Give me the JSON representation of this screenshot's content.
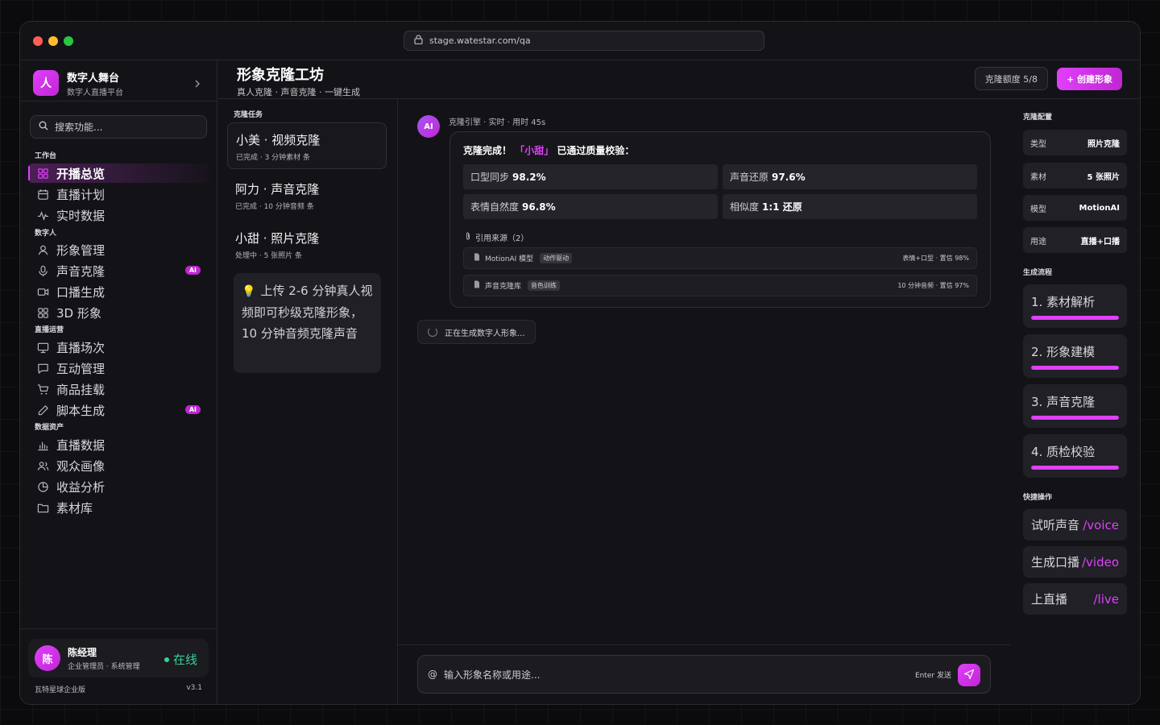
{
  "browser": {
    "url": "stage.watestar.com/qa"
  },
  "sidebar": {
    "brand_logo": "人",
    "brand_title": "数字人舞台",
    "brand_sub": "数字人直播平台",
    "search_placeholder": "搜索功能...",
    "groups": [
      {
        "label": "工作台",
        "items": [
          {
            "label": "开播总览",
            "icon": "grid-icon",
            "active": true
          },
          {
            "label": "直播计划",
            "icon": "calendar-icon"
          },
          {
            "label": "实时数据",
            "icon": "activity-icon"
          }
        ]
      },
      {
        "label": "数字人",
        "items": [
          {
            "label": "形象管理",
            "icon": "user-icon"
          },
          {
            "label": "声音克隆",
            "icon": "mic-icon",
            "badge": "AI"
          },
          {
            "label": "口播生成",
            "icon": "video-icon"
          },
          {
            "label": "3D 形象",
            "icon": "grid-icon"
          }
        ]
      },
      {
        "label": "直播运营",
        "items": [
          {
            "label": "直播场次",
            "icon": "monitor-icon"
          },
          {
            "label": "互动管理",
            "icon": "message-icon"
          },
          {
            "label": "商品挂载",
            "icon": "cart-icon"
          },
          {
            "label": "脚本生成",
            "icon": "pen-icon",
            "badge": "AI"
          }
        ]
      },
      {
        "label": "数据资产",
        "items": [
          {
            "label": "直播数据",
            "icon": "bar-chart-icon"
          },
          {
            "label": "观众画像",
            "icon": "users-icon"
          },
          {
            "label": "收益分析",
            "icon": "pie-icon"
          },
          {
            "label": "素材库",
            "icon": "folder-icon"
          }
        ]
      }
    ],
    "user": {
      "avatar": "陈",
      "name": "陈经理",
      "role": "企业管理员 · 系统管理",
      "status": "在线"
    },
    "footer_left": "瓦特星球企业版",
    "footer_right": "v3.1"
  },
  "header": {
    "title": "形象克隆工坊",
    "subtitle": "真人克隆 · 声音克隆 · 一键生成",
    "quota": "克隆额度 5/8",
    "create_label": "+ 创建形象"
  },
  "tasks": {
    "label": "克隆任务",
    "items": [
      {
        "title": "小美 · 视频克隆",
        "meta": "已完成 · 3 分钟素材 条",
        "active": true
      },
      {
        "title": "阿力 · 声音克隆",
        "meta": "已完成 · 10 分钟音频 条"
      },
      {
        "title": "小甜 · 照片克隆",
        "meta": "处理中 · 5 张照片 条"
      }
    ],
    "tip_icon": "lightbulb-icon",
    "tip": "上传 2-6 分钟真人视频即可秒级克隆形象，10 分钟音频克隆声音"
  },
  "chat": {
    "bot_avatar": "AI",
    "meta": "克隆引擎 · 实时 · 用时 45s",
    "head_prefix": "克隆完成！",
    "head_name": "「小甜」",
    "head_suffix": "已通过质量校验：",
    "metrics": [
      {
        "label": "口型同步",
        "value": "98.2%"
      },
      {
        "label": "声音还原",
        "value": "97.6%"
      },
      {
        "label": "表情自然度",
        "value": "96.8%"
      },
      {
        "label": "相似度",
        "value": "1:1 还原"
      }
    ],
    "refs_label": "引用来源（2）",
    "refs": [
      {
        "name": "MotionAI 模型",
        "tag": "动作驱动",
        "meta": "表情+口型 · 置信 98%"
      },
      {
        "name": "声音克隆库",
        "tag": "音色训练",
        "meta": "10 分钟音频 · 置信 97%"
      }
    ],
    "loading": "正在生成数字人形象...",
    "input_placeholder": "输入形象名称或用途...",
    "input_prefix": "@",
    "send_hint": "Enter 发送"
  },
  "config": {
    "label": "克隆配置",
    "rows": [
      {
        "key": "类型",
        "value": "照片克隆"
      },
      {
        "key": "素材",
        "value": "5 张照片"
      },
      {
        "key": "模型",
        "value": "MotionAI"
      },
      {
        "key": "用途",
        "value": "直播+口播"
      }
    ],
    "flow_label": "生成流程",
    "steps": [
      {
        "label": "1. 素材解析",
        "progress": 1.0
      },
      {
        "label": "2. 形象建模",
        "progress": 1.0
      },
      {
        "label": "3. 声音克隆",
        "progress": 1.0
      },
      {
        "label": "4. 质检校验",
        "progress": 1.0
      }
    ],
    "quick_label": "快捷操作",
    "quick": [
      {
        "label": "试听声音",
        "cmd": "/voice"
      },
      {
        "label": "生成口播",
        "cmd": "/video"
      },
      {
        "label": "上直播",
        "cmd": "/live"
      }
    ]
  },
  "colors": {
    "accent": "#e040fb",
    "online": "#34d399",
    "background": "#131317"
  }
}
